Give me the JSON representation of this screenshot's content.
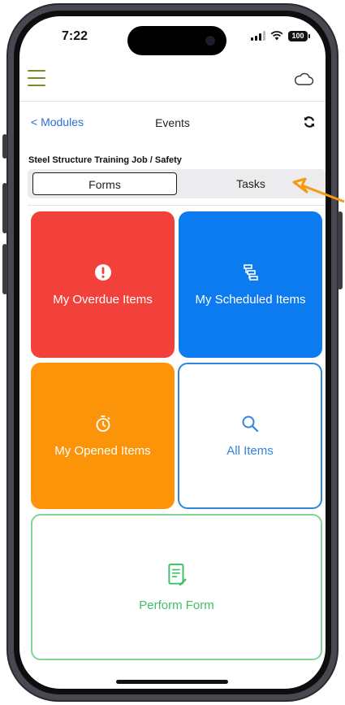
{
  "status_bar": {
    "time": "7:22",
    "battery": "100"
  },
  "header": {
    "menu_icon": "hamburger-icon",
    "cloud_icon": "cloud-icon",
    "accent_color": "#7d8a2c"
  },
  "nav": {
    "back_label": "< Modules",
    "title": "Events",
    "refresh_icon": "refresh-icon"
  },
  "breadcrumb": "Steel Structure Training Job / Safety",
  "segments": {
    "forms": "Forms",
    "tasks": "Tasks",
    "selected": "Forms"
  },
  "tiles": {
    "overdue": {
      "label": "My Overdue Items",
      "icon": "alert-icon",
      "color": "#f2413a"
    },
    "scheduled": {
      "label": "My Scheduled Items",
      "icon": "schedule-icon",
      "color": "#0d7bf0"
    },
    "opened": {
      "label": "My Opened Items",
      "icon": "timer-icon",
      "color": "#fb9408"
    },
    "all": {
      "label": "All Items",
      "icon": "search-icon",
      "color": "#2f85e0"
    },
    "perform": {
      "label": "Perform Form",
      "icon": "form-icon",
      "color": "#3fbf68"
    }
  },
  "annotation": {
    "arrow_color": "#f39c12"
  }
}
